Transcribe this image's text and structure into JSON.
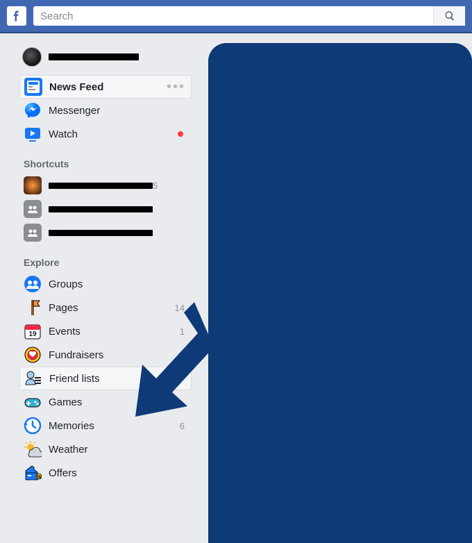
{
  "colors": {
    "brand": "#4267b2",
    "accent_dark": "#0e3a78",
    "notif_red": "#fa3e3e"
  },
  "search": {
    "placeholder": "Search"
  },
  "profile": {
    "name_redacted": true
  },
  "nav": {
    "main": [
      {
        "key": "news-feed",
        "label": "News Feed",
        "icon": "news-feed-icon",
        "selected": true,
        "has_menu": true
      },
      {
        "key": "messenger",
        "label": "Messenger",
        "icon": "messenger-icon"
      },
      {
        "key": "watch",
        "label": "Watch",
        "icon": "watch-icon",
        "has_red_dot": true
      }
    ]
  },
  "shortcuts": {
    "header": "Shortcuts",
    "items": [
      {
        "key": "sc1",
        "label_redacted": true,
        "count": "5"
      },
      {
        "key": "sc2",
        "label_redacted": true
      },
      {
        "key": "sc3",
        "label_redacted": true
      }
    ]
  },
  "explore": {
    "header": "Explore",
    "items": [
      {
        "key": "groups",
        "label": "Groups",
        "icon": "groups-icon"
      },
      {
        "key": "pages",
        "label": "Pages",
        "icon": "pages-icon",
        "count": "14"
      },
      {
        "key": "events",
        "label": "Events",
        "icon": "events-icon",
        "count": "1",
        "badge_text": "19"
      },
      {
        "key": "fundraisers",
        "label": "Fundraisers",
        "icon": "fundraisers-icon"
      },
      {
        "key": "friend-lists",
        "label": "Friend lists",
        "icon": "friend-lists-icon",
        "hovered": true
      },
      {
        "key": "games",
        "label": "Games",
        "icon": "games-icon"
      },
      {
        "key": "memories",
        "label": "Memories",
        "icon": "memories-icon",
        "count": "6"
      },
      {
        "key": "weather",
        "label": "Weather",
        "icon": "weather-icon"
      },
      {
        "key": "offers",
        "label": "Offers",
        "icon": "offers-icon"
      }
    ]
  },
  "annotation": {
    "arrow_points_to": "friend-lists"
  }
}
